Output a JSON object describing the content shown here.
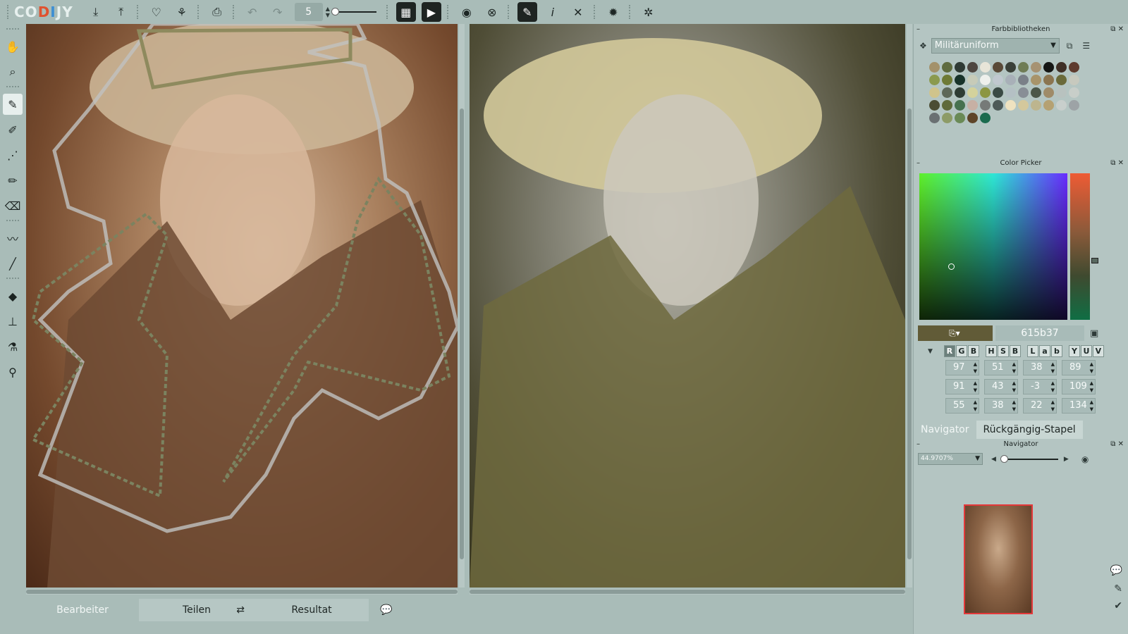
{
  "app": {
    "logo": "CODIJY"
  },
  "toolbar": {
    "brush_size": "5"
  },
  "panels": {
    "library": {
      "title": "Farbbibliotheken",
      "selected": "Militäruniform",
      "swatches": [
        "#a3916a",
        "#5f6b3f",
        "#2f3a34",
        "#4e4640",
        "#e8e5d8",
        "#5a4a38",
        "#3a4038",
        "#6f7c55",
        "#a69272",
        "#151614",
        "#3f2f26",
        "#5e3b2e",
        "#8b9a4e",
        "#6e7a35",
        "#18332a",
        "#c7cbb8",
        "#eef0ec",
        "#c0c8cf",
        "#a8b0b8",
        "#7a8088",
        "#a8946a",
        "#8b7550",
        "#6a6a3a",
        "#c7c9be",
        "#d0c48b",
        "#5e6858",
        "#2e3c34",
        "#d4d29c",
        "#8c9642",
        "#3a4a44",
        "#b4c0c4",
        "#888e96",
        "#4c5648",
        "#9f8b68",
        "#b8c2bf",
        "#c8cec9",
        "#4b4d33",
        "#5f6a3a",
        "#46714f",
        "#c7b0a4",
        "#767a78",
        "#4e5a58",
        "#efe2c0",
        "#d4c89c",
        "#bdb58e",
        "#b5a172",
        "#c8cfcc",
        "#9da3a6",
        "#6a7072",
        "#8d9b66",
        "#6a8a56",
        "#5e4428",
        "#1a6b4e"
      ]
    },
    "picker": {
      "title": "Color Picker",
      "hex": "615b37",
      "modes": [
        [
          "R",
          "G",
          "B"
        ],
        [
          "H",
          "S",
          "B"
        ],
        [
          "L",
          "a",
          "b"
        ],
        [
          "Y",
          "U",
          "V"
        ]
      ],
      "values": [
        [
          "97",
          "51",
          "38",
          "89"
        ],
        [
          "91",
          "43",
          "-3",
          "109"
        ],
        [
          "55",
          "38",
          "22",
          "134"
        ]
      ]
    },
    "navigator": {
      "tab_nav": "Navigator",
      "tab_undo": "Rückgängig-Stapel",
      "title": "Navigator",
      "zoom": "44.9707%"
    }
  },
  "bottom": {
    "tab_edit": "Bearbeiter",
    "tab_split": "Teilen",
    "tab_result": "Resultat"
  }
}
